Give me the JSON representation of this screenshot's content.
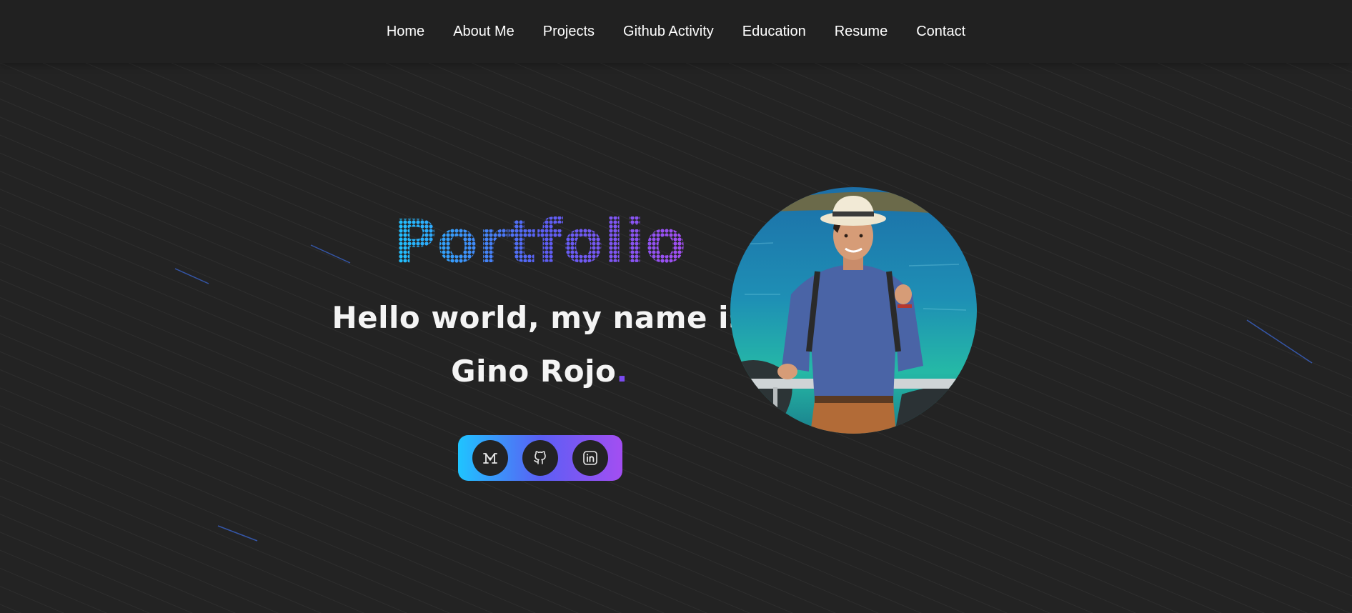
{
  "nav": {
    "items": [
      {
        "label": "Home"
      },
      {
        "label": "About Me"
      },
      {
        "label": "Projects"
      },
      {
        "label": "Github Activity"
      },
      {
        "label": "Education"
      },
      {
        "label": "Resume"
      },
      {
        "label": "Contact"
      }
    ]
  },
  "hero": {
    "title": "Portfolio",
    "greeting": "Hello world, my name is",
    "name": "Gino Rojo",
    "name_dot": "."
  },
  "social": [
    {
      "icon": "medium-icon"
    },
    {
      "icon": "github-icon"
    },
    {
      "icon": "linkedin-icon"
    }
  ],
  "colors": {
    "background": "#232323",
    "navbar": "#212121",
    "gradient_start": "#1fc4ff",
    "gradient_mid": "#5a5ff4",
    "gradient_end": "#a34ef2",
    "accent_dot": "#7b4bf0"
  }
}
